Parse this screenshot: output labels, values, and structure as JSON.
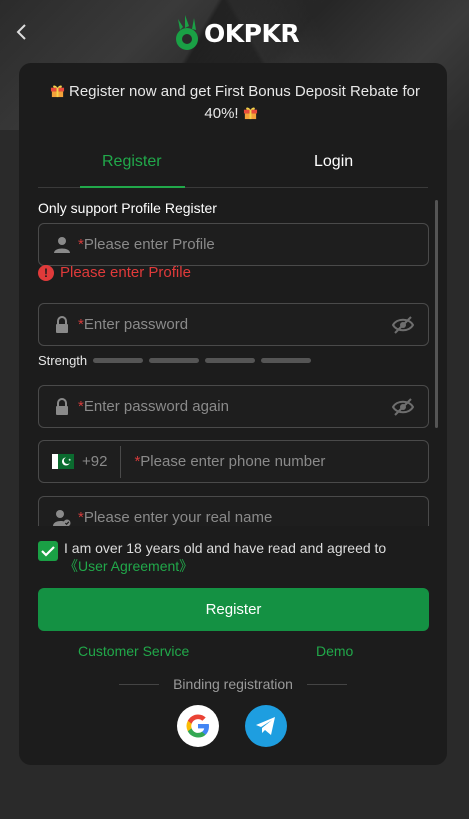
{
  "header": {
    "logo_text": "OKPKR"
  },
  "promo": {
    "text": "Register now and get First Bonus Deposit Rebate for 40%!"
  },
  "tabs": [
    {
      "label": "Register",
      "active": true
    },
    {
      "label": "Login",
      "active": false
    }
  ],
  "form": {
    "section_label": "Only support Profile Register",
    "profile": {
      "required_mark": "*",
      "placeholder": "Please enter Profile"
    },
    "profile_error": "Please enter Profile",
    "password": {
      "required_mark": "*",
      "placeholder": "Enter password"
    },
    "strength_label": "Strength",
    "password_again": {
      "required_mark": "*",
      "placeholder": "Enter password again"
    },
    "phone": {
      "country_code": "+92",
      "required_mark": "*",
      "placeholder": "Please enter phone number"
    },
    "real_name": {
      "required_mark": "*",
      "placeholder": "Please enter your real name"
    }
  },
  "agreement": {
    "checked": true,
    "text": "I am over 18 years old and have read and agreed to ",
    "link": "《User Agreement》"
  },
  "register_button": "Register",
  "links": {
    "customer_service": "Customer Service",
    "demo": "Demo"
  },
  "binding_label": "Binding registration",
  "colors": {
    "accent": "#149143",
    "accent_text": "#21a84a",
    "error": "#e03a3a",
    "card_bg": "#1c1c1c",
    "telegram": "#1e9ee0"
  },
  "icons": [
    "chevron-left-icon",
    "gift-icon",
    "user-icon",
    "lock-icon",
    "eye-off-icon",
    "pakistan-flag-icon",
    "user-check-icon",
    "check-icon",
    "error-icon",
    "google-icon",
    "telegram-icon"
  ]
}
